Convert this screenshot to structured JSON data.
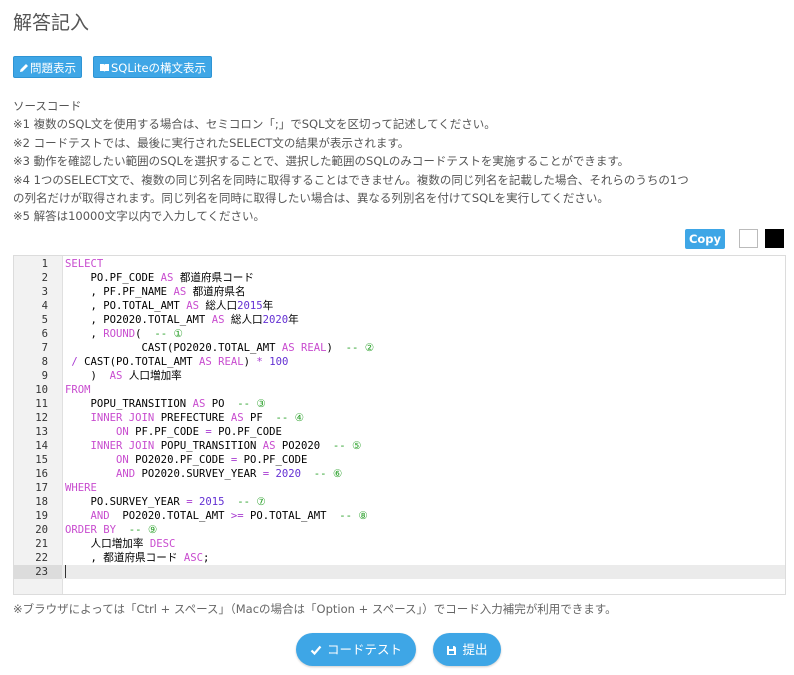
{
  "page": {
    "title": "解答記入"
  },
  "toolbar": {
    "problem_label": "問題表示",
    "syntax_label": "SQLiteの構文表示"
  },
  "notes": {
    "heading": "ソースコード",
    "note1": "※1 複数のSQL文を使用する場合は、セミコロン「;」でSQL文を区切って記述してください。",
    "note2": "※2 コードテストでは、最後に実行されたSELECT文の結果が表示されます。",
    "note3": "※3 動作を確認したい範囲のSQLを選択することで、選択した範囲のSQLのみコードテストを実施することができます。",
    "note4a": "※4 1つのSELECT文で、複数の同じ列名を同時に取得することはできません。複数の同じ列名を記載した場合、それらのうちの1つ",
    "note4b": "の列名だけが取得されます。同じ列名を同時に取得したい場合は、異なる列別名を付けてSQLを実行してください。",
    "note5": "※5 解答は10000文字以内で入力してください。"
  },
  "editor": {
    "copy_label": "Copy",
    "theme_colors": [
      "#ffffff",
      "#000000"
    ],
    "active_line": 23,
    "lines": [
      [
        [
          "kw",
          "SELECT"
        ]
      ],
      [
        [
          "t",
          "    PO.PF_CODE "
        ],
        [
          "kw",
          "AS"
        ],
        [
          "t",
          " 都道府県コード"
        ]
      ],
      [
        [
          "t",
          "    , PF.PF_NAME "
        ],
        [
          "kw",
          "AS"
        ],
        [
          "t",
          " 都道府県名"
        ]
      ],
      [
        [
          "t",
          "    , PO.TOTAL_AMT "
        ],
        [
          "kw",
          "AS"
        ],
        [
          "t",
          " 総人口"
        ],
        [
          "num",
          "2015"
        ],
        [
          "t",
          "年"
        ]
      ],
      [
        [
          "t",
          "    , PO2020.TOTAL_AMT "
        ],
        [
          "kw",
          "AS"
        ],
        [
          "t",
          " 総人口"
        ],
        [
          "num",
          "2020"
        ],
        [
          "t",
          "年"
        ]
      ],
      [
        [
          "t",
          "    , "
        ],
        [
          "kw",
          "ROUND"
        ],
        [
          "t",
          "(  "
        ],
        [
          "cm",
          "-- ①"
        ]
      ],
      [
        [
          "t",
          "            CAST(PO2020.TOTAL_AMT "
        ],
        [
          "kw",
          "AS"
        ],
        [
          "t",
          " "
        ],
        [
          "kw",
          "REAL"
        ],
        [
          "t",
          ")  "
        ],
        [
          "cm",
          "-- ②"
        ]
      ],
      [
        [
          "t",
          " "
        ],
        [
          "op",
          "/"
        ],
        [
          "t",
          " CAST(PO.TOTAL_AMT "
        ],
        [
          "kw",
          "AS"
        ],
        [
          "t",
          " "
        ],
        [
          "kw",
          "REAL"
        ],
        [
          "t",
          ") "
        ],
        [
          "op",
          "*"
        ],
        [
          "t",
          " "
        ],
        [
          "num",
          "100"
        ]
      ],
      [
        [
          "t",
          "    )  "
        ],
        [
          "kw",
          "AS"
        ],
        [
          "t",
          " 人口増加率"
        ]
      ],
      [
        [
          "kw",
          "FROM"
        ]
      ],
      [
        [
          "t",
          "    POPU_TRANSITION "
        ],
        [
          "kw",
          "AS"
        ],
        [
          "t",
          " PO  "
        ],
        [
          "cm",
          "-- ③"
        ]
      ],
      [
        [
          "t",
          "    "
        ],
        [
          "kw",
          "INNER"
        ],
        [
          "t",
          " "
        ],
        [
          "kw",
          "JOIN"
        ],
        [
          "t",
          " PREFECTURE "
        ],
        [
          "kw",
          "AS"
        ],
        [
          "t",
          " PF  "
        ],
        [
          "cm",
          "-- ④"
        ]
      ],
      [
        [
          "t",
          "        "
        ],
        [
          "kw",
          "ON"
        ],
        [
          "t",
          " PF.PF_CODE "
        ],
        [
          "op",
          "="
        ],
        [
          "t",
          " PO.PF_CODE"
        ]
      ],
      [
        [
          "t",
          "    "
        ],
        [
          "kw",
          "INNER"
        ],
        [
          "t",
          " "
        ],
        [
          "kw",
          "JOIN"
        ],
        [
          "t",
          " POPU_TRANSITION "
        ],
        [
          "kw",
          "AS"
        ],
        [
          "t",
          " PO2020  "
        ],
        [
          "cm",
          "-- ⑤"
        ]
      ],
      [
        [
          "t",
          "        "
        ],
        [
          "kw",
          "ON"
        ],
        [
          "t",
          " PO2020.PF_CODE "
        ],
        [
          "op",
          "="
        ],
        [
          "t",
          " PO.PF_CODE"
        ]
      ],
      [
        [
          "t",
          "        "
        ],
        [
          "kw",
          "AND"
        ],
        [
          "t",
          " PO2020.SURVEY_YEAR "
        ],
        [
          "op",
          "="
        ],
        [
          "t",
          " "
        ],
        [
          "num",
          "2020"
        ],
        [
          "t",
          "  "
        ],
        [
          "cm",
          "-- ⑥"
        ]
      ],
      [
        [
          "kw",
          "WHERE"
        ]
      ],
      [
        [
          "t",
          "    PO.SURVEY_YEAR "
        ],
        [
          "op",
          "="
        ],
        [
          "t",
          " "
        ],
        [
          "num",
          "2015"
        ],
        [
          "t",
          "  "
        ],
        [
          "cm",
          "-- ⑦"
        ]
      ],
      [
        [
          "t",
          "    "
        ],
        [
          "kw",
          "AND"
        ],
        [
          "t",
          "  PO2020.TOTAL_AMT "
        ],
        [
          "op",
          ">="
        ],
        [
          "t",
          " PO.TOTAL_AMT  "
        ],
        [
          "cm",
          "-- ⑧"
        ]
      ],
      [
        [
          "kw",
          "ORDER BY"
        ],
        [
          "t",
          "  "
        ],
        [
          "cm",
          "-- ⑨"
        ]
      ],
      [
        [
          "t",
          "    人口増加率 "
        ],
        [
          "kw",
          "DESC"
        ]
      ],
      [
        [
          "t",
          "    , 都道府県コード "
        ],
        [
          "kw",
          "ASC"
        ],
        [
          "t",
          ";"
        ]
      ],
      []
    ]
  },
  "hint": "※ブラウザによっては「Ctrl + スペース」（Macの場合は「Option + スペース」）でコード入力補完が利用できます。",
  "actions": {
    "test_label": "コードテスト",
    "submit_label": "提出"
  }
}
